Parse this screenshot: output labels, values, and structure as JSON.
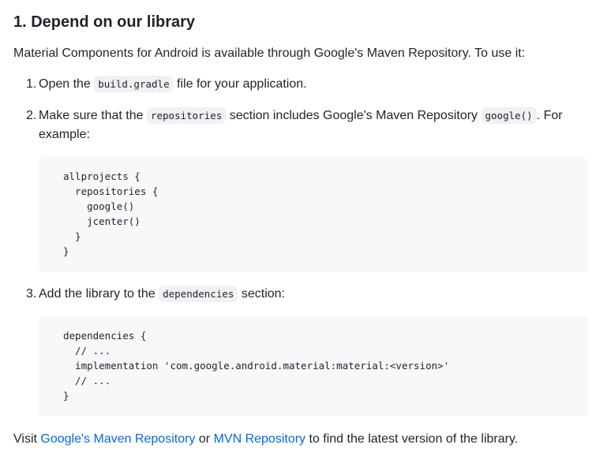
{
  "heading": "1. Depend on our library",
  "intro": "Material Components for Android is available through Google's Maven Repository. To use it:",
  "steps": [
    {
      "number": "1.",
      "parts": [
        "Open the ",
        "build.gradle",
        " file for your application."
      ]
    },
    {
      "number": "2.",
      "parts": [
        "Make sure that the ",
        "repositories",
        " section includes Google's Maven Repository ",
        "google()",
        ". For example:"
      ]
    },
    {
      "number": "3.",
      "parts": [
        "Add the library to the ",
        "dependencies",
        " section:"
      ]
    }
  ],
  "code_blocks": [
    "allprojects {\n  repositories {\n    google()\n    jcenter()\n  }\n}",
    "dependencies {\n  // ...\n  implementation 'com.google.android.material:material:<version>'\n  // ...\n}"
  ],
  "footer": {
    "prefix": "Visit ",
    "link1": "Google's Maven Repository",
    "middle": " or ",
    "link2": "MVN Repository",
    "suffix": " to find the latest version of the library."
  },
  "colors": {
    "text": "#1f2328",
    "link": "#0969da",
    "code_bg": "#f6f8fa",
    "inline_code_bg": "#eff1f3"
  }
}
